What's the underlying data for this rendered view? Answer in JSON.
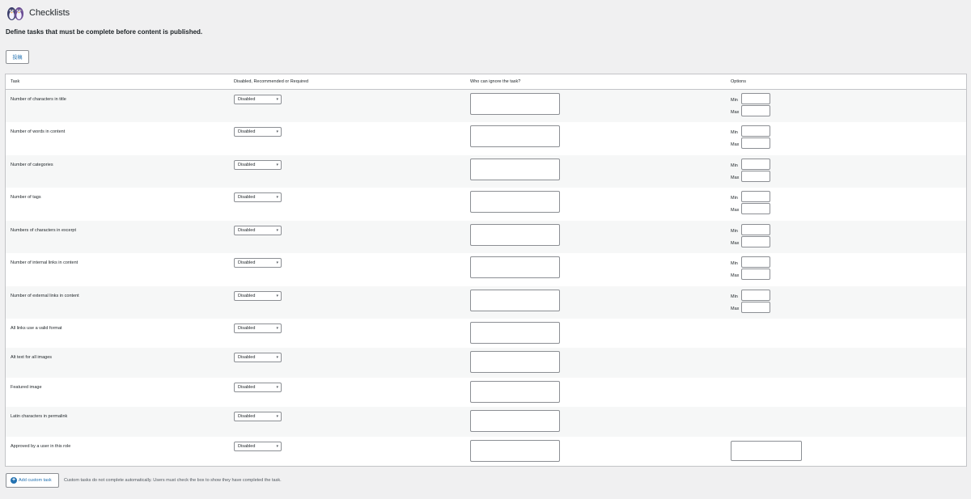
{
  "header": {
    "title": "Checklists",
    "subtitle": "Define tasks that must be complete before content is published."
  },
  "post_type_tab": "投稿",
  "table": {
    "columns": [
      "Task",
      "Disabled, Recommended or Required",
      "Who can ignore the task?",
      "Options"
    ],
    "min_label": "Min",
    "max_label": "Max",
    "rows": [
      {
        "task": "Number of characters in title",
        "status": "Disabled"
      },
      {
        "task": "Number of words in content",
        "status": "Disabled"
      },
      {
        "task": "Number of categories",
        "status": "Disabled"
      },
      {
        "task": "Number of tags",
        "status": "Disabled"
      },
      {
        "task": "Numbers of characters in excerpt",
        "status": "Disabled"
      },
      {
        "task": "Number of internal links in content",
        "status": "Disabled"
      },
      {
        "task": "Number of external links in content",
        "status": "Disabled"
      },
      {
        "task": "All links use a valid format",
        "status": "Disabled"
      },
      {
        "task": "Alt text for all images",
        "status": "Disabled"
      },
      {
        "task": "Featured image",
        "status": "Disabled"
      },
      {
        "task": "Latin characters in permalink",
        "status": "Disabled"
      },
      {
        "task": "Approved by a user in this role",
        "status": "Disabled"
      }
    ]
  },
  "footer": {
    "add_button": "Add custom task",
    "help": "Custom tasks do not complete automatically. Users must check the box to show they have completed the task."
  },
  "colors": {
    "accent": "#2271b1",
    "row_alt": "#f6f7f7",
    "background": "#f0f0f1"
  }
}
